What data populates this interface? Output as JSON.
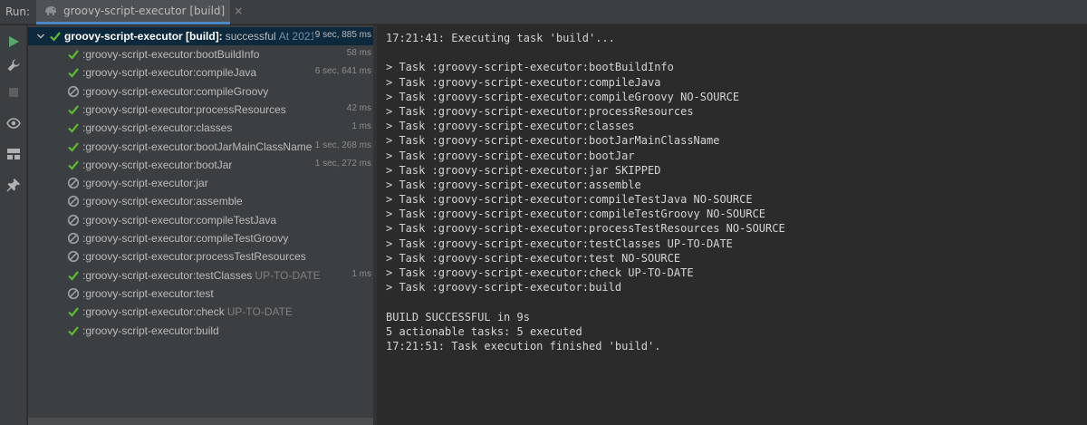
{
  "run_bar": {
    "run_label": "Run:",
    "tab_title": "groovy-script-executor [build]",
    "tab_close": "×",
    "tab_icon": "elephant-gradle-icon"
  },
  "toolbar": {
    "buttons": [
      "run-icon",
      "wrench-icon",
      "stop-icon",
      "eye-icon",
      "layout-icon",
      "pin-icon"
    ]
  },
  "tree": {
    "root": {
      "label": "groovy-script-executor [build]:",
      "status": "successful",
      "suffix": "At 2021",
      "time": "9 sec, 885 ms"
    },
    "tasks": [
      {
        "label": ":groovy-script-executor:bootBuildInfo",
        "suffix": "",
        "time": "58 ms",
        "state": "success"
      },
      {
        "label": ":groovy-script-executor:compileJava",
        "suffix": "",
        "time": "6 sec, 641 ms",
        "state": "success"
      },
      {
        "label": ":groovy-script-executor:compileGroovy",
        "suffix": "",
        "time": "",
        "state": "skipped"
      },
      {
        "label": ":groovy-script-executor:processResources",
        "suffix": "",
        "time": "42 ms",
        "state": "success"
      },
      {
        "label": ":groovy-script-executor:classes",
        "suffix": "",
        "time": "1 ms",
        "state": "success"
      },
      {
        "label": ":groovy-script-executor:bootJarMainClassName",
        "suffix": "",
        "time": "1 sec, 268 ms",
        "state": "success"
      },
      {
        "label": ":groovy-script-executor:bootJar",
        "suffix": "",
        "time": "1 sec, 272 ms",
        "state": "success"
      },
      {
        "label": ":groovy-script-executor:jar",
        "suffix": "",
        "time": "",
        "state": "skipped"
      },
      {
        "label": ":groovy-script-executor:assemble",
        "suffix": "",
        "time": "",
        "state": "skipped"
      },
      {
        "label": ":groovy-script-executor:compileTestJava",
        "suffix": "",
        "time": "",
        "state": "skipped"
      },
      {
        "label": ":groovy-script-executor:compileTestGroovy",
        "suffix": "",
        "time": "",
        "state": "skipped"
      },
      {
        "label": ":groovy-script-executor:processTestResources",
        "suffix": "",
        "time": "",
        "state": "skipped"
      },
      {
        "label": ":groovy-script-executor:testClasses",
        "suffix": "UP-TO-DATE",
        "time": "1 ms",
        "state": "success"
      },
      {
        "label": ":groovy-script-executor:test",
        "suffix": "",
        "time": "",
        "state": "skipped"
      },
      {
        "label": ":groovy-script-executor:check",
        "suffix": "UP-TO-DATE",
        "time": "",
        "state": "success"
      },
      {
        "label": ":groovy-script-executor:build",
        "suffix": "",
        "time": "",
        "state": "success"
      }
    ]
  },
  "console": {
    "lines": [
      "17:21:41: Executing task 'build'...",
      "",
      "> Task :groovy-script-executor:bootBuildInfo",
      "> Task :groovy-script-executor:compileJava",
      "> Task :groovy-script-executor:compileGroovy NO-SOURCE",
      "> Task :groovy-script-executor:processResources",
      "> Task :groovy-script-executor:classes",
      "> Task :groovy-script-executor:bootJarMainClassName",
      "> Task :groovy-script-executor:bootJar",
      "> Task :groovy-script-executor:jar SKIPPED",
      "> Task :groovy-script-executor:assemble",
      "> Task :groovy-script-executor:compileTestJava NO-SOURCE",
      "> Task :groovy-script-executor:compileTestGroovy NO-SOURCE",
      "> Task :groovy-script-executor:processTestResources NO-SOURCE",
      "> Task :groovy-script-executor:testClasses UP-TO-DATE",
      "> Task :groovy-script-executor:test NO-SOURCE",
      "> Task :groovy-script-executor:check UP-TO-DATE",
      "> Task :groovy-script-executor:build",
      "",
      "BUILD SUCCESSFUL in 9s",
      "5 actionable tasks: 5 executed",
      "17:21:51: Task execution finished 'build'."
    ]
  },
  "colors": {
    "success": "#5fb832",
    "skipped": "#9aa0a6",
    "run_green": "#59a869",
    "accent": "#4a88c7"
  }
}
